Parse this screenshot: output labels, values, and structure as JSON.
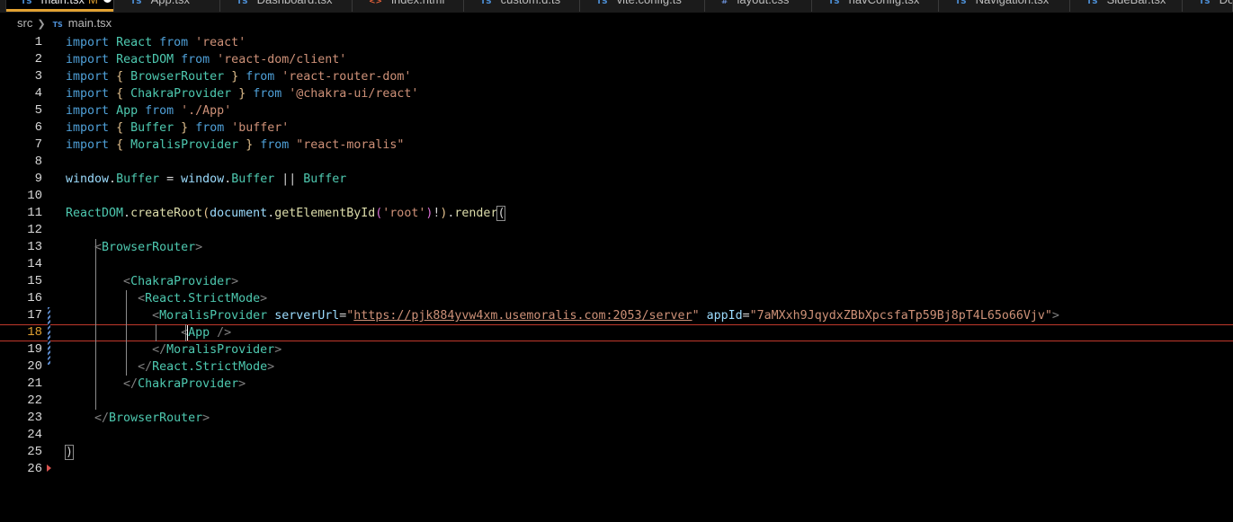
{
  "tabs": [
    {
      "icon": "TS",
      "label": "main.tsx",
      "badge": "M",
      "active": true,
      "dirty": true
    },
    {
      "icon": "TS",
      "label": "App.tsx"
    },
    {
      "icon": "TS",
      "label": "Dashboard.tsx"
    },
    {
      "icon": "<>",
      "label": "index.html"
    },
    {
      "icon": "TS",
      "label": "custom.d.ts"
    },
    {
      "icon": "TS",
      "label": "vite.config.ts"
    },
    {
      "icon": "#",
      "label": "layout.css"
    },
    {
      "icon": "TS",
      "label": "navConfig.tsx"
    },
    {
      "icon": "TS",
      "label": "Navigation.tsx"
    },
    {
      "icon": "TS",
      "label": "SideBar.tsx"
    },
    {
      "icon": "TS",
      "label": "Do"
    }
  ],
  "breadcrumb": {
    "folder": "src",
    "file_icon": "TS",
    "file": "main.tsx"
  },
  "editor": {
    "current_line": 18,
    "lines": [
      [
        [
          "kw",
          "import"
        ],
        [
          "plain",
          " "
        ],
        [
          "cls",
          "React"
        ],
        [
          "plain",
          " "
        ],
        [
          "from",
          "from"
        ],
        [
          "plain",
          " "
        ],
        [
          "str",
          "'react'"
        ]
      ],
      [
        [
          "kw",
          "import"
        ],
        [
          "plain",
          " "
        ],
        [
          "cls",
          "ReactDOM"
        ],
        [
          "plain",
          " "
        ],
        [
          "from",
          "from"
        ],
        [
          "plain",
          " "
        ],
        [
          "str",
          "'react-dom/client'"
        ]
      ],
      [
        [
          "kw",
          "import"
        ],
        [
          "plain",
          " "
        ],
        [
          "brace",
          "{"
        ],
        [
          "plain",
          " "
        ],
        [
          "cls",
          "BrowserRouter"
        ],
        [
          "plain",
          " "
        ],
        [
          "brace",
          "}"
        ],
        [
          "plain",
          " "
        ],
        [
          "from",
          "from"
        ],
        [
          "plain",
          " "
        ],
        [
          "str",
          "'react-router-dom'"
        ]
      ],
      [
        [
          "kw",
          "import"
        ],
        [
          "plain",
          " "
        ],
        [
          "brace",
          "{"
        ],
        [
          "plain",
          " "
        ],
        [
          "cls",
          "ChakraProvider"
        ],
        [
          "plain",
          " "
        ],
        [
          "brace",
          "}"
        ],
        [
          "plain",
          " "
        ],
        [
          "from",
          "from"
        ],
        [
          "plain",
          " "
        ],
        [
          "str",
          "'@chakra-ui/react'"
        ]
      ],
      [
        [
          "kw",
          "import"
        ],
        [
          "plain",
          " "
        ],
        [
          "cls",
          "App"
        ],
        [
          "plain",
          " "
        ],
        [
          "from",
          "from"
        ],
        [
          "plain",
          " "
        ],
        [
          "str",
          "'./App'"
        ]
      ],
      [
        [
          "kw",
          "import"
        ],
        [
          "plain",
          " "
        ],
        [
          "brace",
          "{"
        ],
        [
          "plain",
          " "
        ],
        [
          "cls",
          "Buffer"
        ],
        [
          "plain",
          " "
        ],
        [
          "brace",
          "}"
        ],
        [
          "plain",
          " "
        ],
        [
          "from",
          "from"
        ],
        [
          "plain",
          " "
        ],
        [
          "str",
          "'buffer'"
        ]
      ],
      [
        [
          "kw",
          "import"
        ],
        [
          "plain",
          " "
        ],
        [
          "brace",
          "{"
        ],
        [
          "plain",
          " "
        ],
        [
          "cls",
          "MoralisProvider"
        ],
        [
          "plain",
          " "
        ],
        [
          "brace",
          "}"
        ],
        [
          "plain",
          " "
        ],
        [
          "from",
          "from"
        ],
        [
          "plain",
          " "
        ],
        [
          "str",
          "\"react-moralis\""
        ]
      ],
      [],
      [
        [
          "id",
          "window"
        ],
        [
          "plain",
          "."
        ],
        [
          "cls",
          "Buffer"
        ],
        [
          "plain",
          " = "
        ],
        [
          "id",
          "window"
        ],
        [
          "plain",
          "."
        ],
        [
          "cls",
          "Buffer"
        ],
        [
          "plain",
          " || "
        ],
        [
          "cls",
          "Buffer"
        ]
      ],
      [],
      [
        [
          "cls",
          "ReactDOM"
        ],
        [
          "plain",
          "."
        ],
        [
          "fn",
          "createRoot"
        ],
        [
          "paren",
          "("
        ],
        [
          "id",
          "document"
        ],
        [
          "plain",
          "."
        ],
        [
          "fn",
          "getElementById"
        ],
        [
          "brace2",
          "("
        ],
        [
          "str",
          "'root'"
        ],
        [
          "brace2",
          ")"
        ],
        [
          "plain",
          "!"
        ],
        [
          "paren",
          ")"
        ],
        [
          "plain",
          "."
        ],
        [
          "fn",
          "render"
        ],
        [
          "bmatch",
          "("
        ]
      ],
      [],
      [
        [
          "plain",
          "    "
        ],
        [
          "punct",
          "<"
        ],
        [
          "tag",
          "BrowserRouter"
        ],
        [
          "punct",
          ">"
        ]
      ],
      [],
      [
        [
          "plain",
          "        "
        ],
        [
          "punct",
          "<"
        ],
        [
          "tag",
          "ChakraProvider"
        ],
        [
          "punct",
          ">"
        ]
      ],
      [
        [
          "plain",
          "          "
        ],
        [
          "punct",
          "<"
        ],
        [
          "tag",
          "React.StrictMode"
        ],
        [
          "punct",
          ">"
        ]
      ],
      [
        [
          "plain",
          "            "
        ],
        [
          "punct",
          "<"
        ],
        [
          "tag",
          "MoralisProvider"
        ],
        [
          "plain",
          " "
        ],
        [
          "attr",
          "serverUrl"
        ],
        [
          "plain",
          "="
        ],
        [
          "str",
          "\""
        ],
        [
          "url",
          "https://pjk884yvw4xm.usemoralis.com:2053/server"
        ],
        [
          "str",
          "\""
        ],
        [
          "plain",
          " "
        ],
        [
          "attr",
          "appId"
        ],
        [
          "plain",
          "="
        ],
        [
          "str",
          "\"7aMXxh9JqydxZBbXpcsfaTp59Bj8pT4L65o66Vjv\""
        ],
        [
          "punct",
          ">"
        ]
      ],
      [
        [
          "plain",
          "                "
        ],
        [
          "punct",
          "<"
        ],
        [
          "tag",
          "App"
        ],
        [
          "plain",
          " "
        ],
        [
          "punct",
          "/>"
        ]
      ],
      [
        [
          "plain",
          "            "
        ],
        [
          "punct",
          "</"
        ],
        [
          "tag",
          "MoralisProvider"
        ],
        [
          "punct",
          ">"
        ]
      ],
      [
        [
          "plain",
          "          "
        ],
        [
          "punct",
          "</"
        ],
        [
          "tag",
          "React.StrictMode"
        ],
        [
          "punct",
          ">"
        ]
      ],
      [
        [
          "plain",
          "        "
        ],
        [
          "punct",
          "</"
        ],
        [
          "tag",
          "ChakraProvider"
        ],
        [
          "punct",
          ">"
        ]
      ],
      [],
      [
        [
          "plain",
          "    "
        ],
        [
          "punct",
          "</"
        ],
        [
          "tag",
          "BrowserRouter"
        ],
        [
          "punct",
          ">"
        ]
      ],
      [],
      [
        [
          "bmatch",
          ")"
        ]
      ],
      []
    ]
  }
}
